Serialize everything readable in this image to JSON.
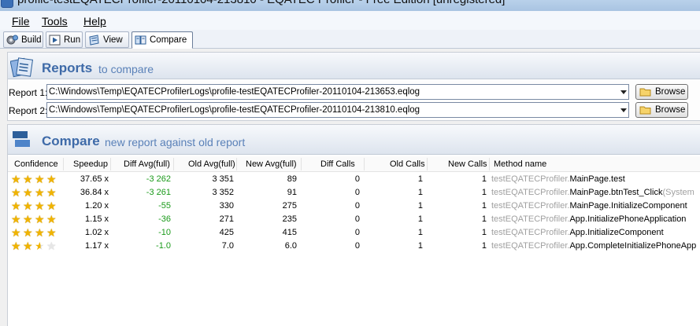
{
  "window": {
    "title": "profile-testEQATECProfiler-20110104-213810 - EQATEC Profiler - Free Edition [unregistered]"
  },
  "menu": [
    {
      "label": "File"
    },
    {
      "label": "Tools"
    },
    {
      "label": "Help"
    }
  ],
  "tabs": [
    {
      "label": "Build",
      "icon": "build-icon",
      "active": false
    },
    {
      "label": "Run",
      "icon": "run-icon",
      "active": false
    },
    {
      "label": "View",
      "icon": "view-icon",
      "active": false
    },
    {
      "label": "Compare",
      "icon": "compare-icon",
      "active": true
    }
  ],
  "reports": {
    "heading_strong": "Reports",
    "heading_light": "to compare",
    "report1": {
      "label": "Report 1:",
      "value": "C:\\Windows\\Temp\\EQATECProfilerLogs\\profile-testEQATECProfiler-20110104-213653.eqlog",
      "browse": "Browse"
    },
    "report2": {
      "label": "Report 2:",
      "value": "C:\\Windows\\Temp\\EQATECProfilerLogs\\profile-testEQATECProfiler-20110104-213810.eqlog",
      "browse": "Browse"
    }
  },
  "compare": {
    "heading_strong": "Compare",
    "heading_light": "new report against old report",
    "columns": [
      "Confidence",
      "Speedup",
      "Diff Avg(full)",
      "Old Avg(full)",
      "New Avg(full)",
      "Diff Calls",
      "Old Calls",
      "New Calls",
      "Method name"
    ],
    "rows": [
      {
        "stars": 4,
        "speedup": "37.65 x",
        "diff_avg": "-3 262",
        "old_avg": "3 351",
        "new_avg": "89",
        "diff_calls": "0",
        "old_calls": "1",
        "new_calls": "1",
        "ns": "testEQATECProfiler.",
        "method": "MainPage.test",
        "suffix": ""
      },
      {
        "stars": 4,
        "speedup": "36.84 x",
        "diff_avg": "-3 261",
        "old_avg": "3 352",
        "new_avg": "91",
        "diff_calls": "0",
        "old_calls": "1",
        "new_calls": "1",
        "ns": "testEQATECProfiler.",
        "method": "MainPage.btnTest_Click",
        "suffix": "(System"
      },
      {
        "stars": 4,
        "speedup": "1.20 x",
        "diff_avg": "-55",
        "old_avg": "330",
        "new_avg": "275",
        "diff_calls": "0",
        "old_calls": "1",
        "new_calls": "1",
        "ns": "testEQATECProfiler.",
        "method": "MainPage.InitializeComponent",
        "suffix": ""
      },
      {
        "stars": 4,
        "speedup": "1.15 x",
        "diff_avg": "-36",
        "old_avg": "271",
        "new_avg": "235",
        "diff_calls": "0",
        "old_calls": "1",
        "new_calls": "1",
        "ns": "testEQATECProfiler.",
        "method": "App.InitializePhoneApplication",
        "suffix": ""
      },
      {
        "stars": 4,
        "speedup": "1.02 x",
        "diff_avg": "-10",
        "old_avg": "425",
        "new_avg": "415",
        "diff_calls": "0",
        "old_calls": "1",
        "new_calls": "1",
        "ns": "testEQATECProfiler.",
        "method": "App.InitializeComponent",
        "suffix": ""
      },
      {
        "stars": 2.5,
        "speedup": "1.17 x",
        "diff_avg": "-1.0",
        "old_avg": "7.0",
        "new_avg": "6.0",
        "diff_calls": "0",
        "old_calls": "1",
        "new_calls": "1",
        "ns": "testEQATECProfiler.",
        "method": "App.CompleteInitializePhoneApp",
        "suffix": ""
      }
    ]
  },
  "colors": {
    "accent": "#3e6aa8",
    "diff_green": "#1a9a1a",
    "namespace_grey": "#a0a0a0",
    "star": "#f0b400"
  }
}
